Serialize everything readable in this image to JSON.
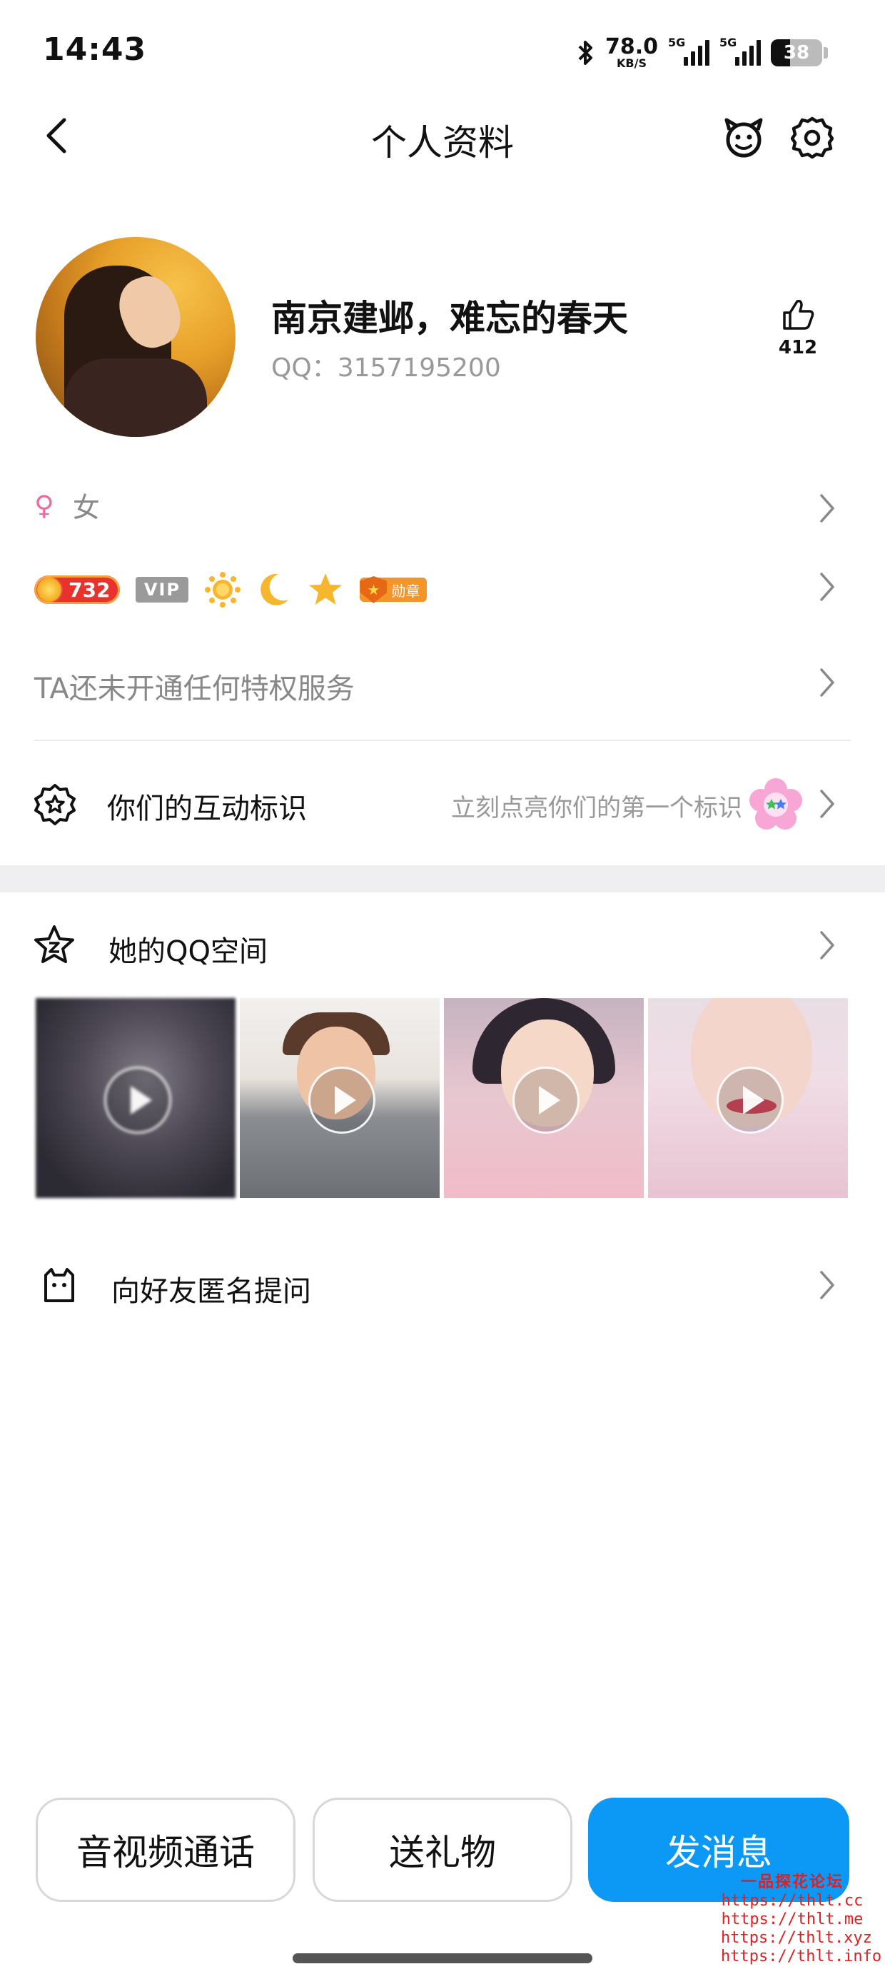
{
  "status_bar": {
    "time": "14:43",
    "net_speed_value": "78.0",
    "net_speed_unit": "KB/S",
    "sim1_label": "5G",
    "sim2_label": "5G",
    "battery_level": "38",
    "battery_fraction": 0.38
  },
  "nav": {
    "title": "个人资料",
    "back_icon": "chevron-left-icon",
    "pet_icon": "pet-face-icon",
    "settings_icon": "gear-icon"
  },
  "profile": {
    "nickname": "南京建邺，难忘的春天",
    "qq_label": "QQ：",
    "qq_number": "3157195200",
    "like_count": "412"
  },
  "gender": {
    "label": "女",
    "icon": "female-symbol-icon"
  },
  "badges": {
    "coin_value": "732",
    "vip_label": "VIP",
    "level_icons": [
      "sun-icon",
      "moon-icon",
      "star-icon"
    ],
    "medal_label": "勋章"
  },
  "privilege": {
    "text": "TA还未开通任何特权服务"
  },
  "interaction": {
    "label": "你们的互动标识",
    "hint": "立刻点亮你们的第一个标识"
  },
  "qzone": {
    "label": "她的QQ空间",
    "videos": [
      "video-1",
      "video-2",
      "video-3",
      "video-4"
    ]
  },
  "anonymous": {
    "label": "向好友匿名提问"
  },
  "actions": {
    "call_label": "音视频通话",
    "gift_label": "送礼物",
    "message_label": "发消息"
  },
  "watermark": {
    "name": "一品探花论坛",
    "urls": [
      "https://thlt.cc",
      "https://thlt.me",
      "https://thlt.xyz",
      "https://thlt.info"
    ]
  },
  "colors": {
    "accent_blue": "#0c99f5",
    "secondary_text": "#999999",
    "female_pink": "#e96ca0",
    "watermark_red": "#e02020"
  }
}
